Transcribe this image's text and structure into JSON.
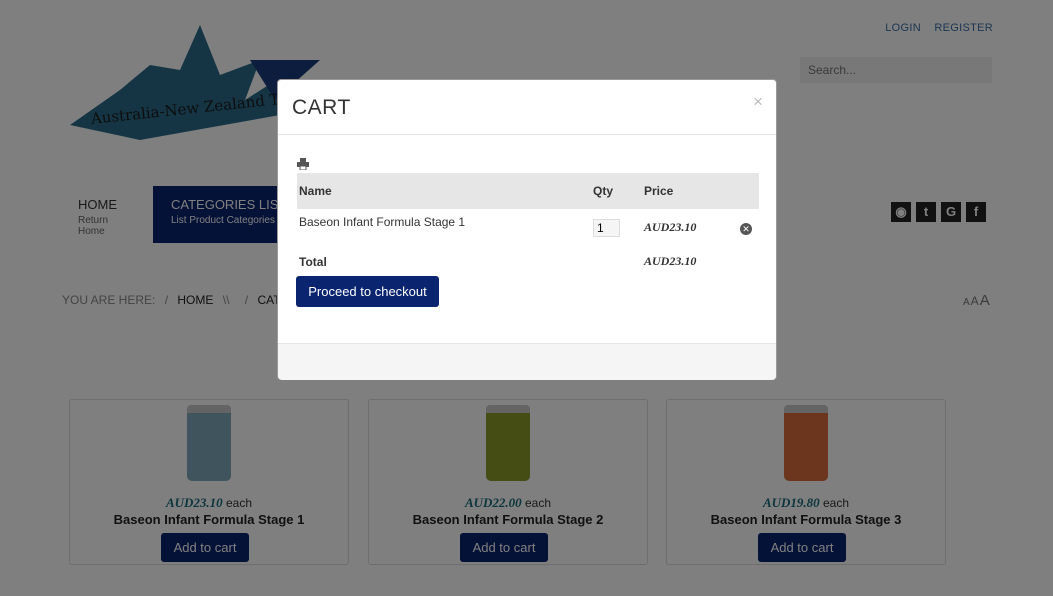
{
  "header": {
    "logo_text": "Australia-New Zealand Trade (",
    "login": "LOGIN",
    "register": "REGISTER",
    "search_placeholder": "Search..."
  },
  "nav": {
    "items": [
      {
        "title": "HOME",
        "subtitle": "Return Home"
      },
      {
        "title": "CATEGORIES LIST",
        "subtitle": "List Product Categories"
      }
    ]
  },
  "social": {
    "icons": [
      "rss-icon",
      "twitter-icon",
      "google-icon",
      "facebook-icon"
    ]
  },
  "breadcrumb": {
    "label": "YOU ARE HERE:",
    "sep": "/",
    "home": "HOME",
    "home_sep": "\\\\",
    "current": "CATEGO"
  },
  "font_size_controls": [
    "A",
    "A",
    "A"
  ],
  "products": [
    {
      "price": "AUD23.10",
      "each": " each",
      "name": "Baseon Infant Formula Stage 1",
      "button": "Add to cart",
      "color": "#7fa8b8"
    },
    {
      "price": "AUD22.00",
      "each": " each",
      "name": "Baseon Infant Formula Stage 2",
      "button": "Add to cart",
      "color": "#8a9a2a"
    },
    {
      "price": "AUD19.80",
      "each": " each",
      "name": "Baseon Infant Formula Stage 3",
      "button": "Add to cart",
      "color": "#d86a3a"
    }
  ],
  "modal": {
    "title": "CART",
    "close": "×",
    "columns": {
      "name": "Name",
      "qty": "Qty",
      "price": "Price"
    },
    "item": {
      "name": "Baseon Infant Formula Stage 1",
      "qty": "1",
      "price": "AUD23.10"
    },
    "total_label": "Total",
    "total_value": "AUD23.10",
    "checkout_label": "Proceed to checkout"
  },
  "colors": {
    "accent": "#0a2470",
    "price": "#1a6a7a"
  }
}
